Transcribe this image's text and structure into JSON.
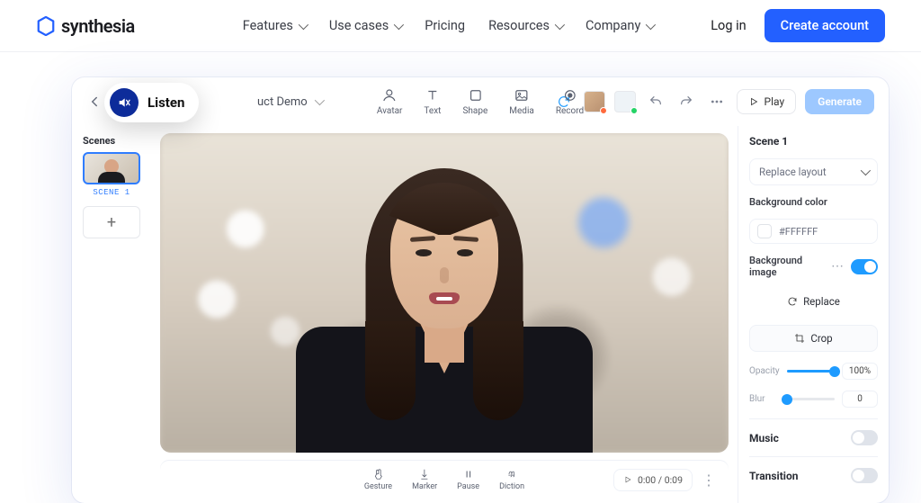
{
  "brand": "synthesia",
  "nav": {
    "items": [
      "Features",
      "Use cases",
      "Pricing",
      "Resources",
      "Company"
    ],
    "login": "Log in",
    "cta": "Create account"
  },
  "listenPill": "Listen",
  "projectName": "uct Demo",
  "toolbar": {
    "avatar": "Avatar",
    "text": "Text",
    "shape": "Shape",
    "media": "Media",
    "record": "Record",
    "play": "Play",
    "generate": "Generate"
  },
  "scenes": {
    "heading": "Scenes",
    "items": [
      {
        "label": "SCENE 1"
      }
    ],
    "add": "+"
  },
  "footer": {
    "gesture": "Gesture",
    "marker": "Marker",
    "pause": "Pause",
    "diction": "Diction",
    "time": "0:00 / 0:09"
  },
  "panel": {
    "sceneTitle": "Scene 1",
    "replaceLayout": "Replace layout",
    "bgColorLabel": "Background color",
    "bgColorValue": "#FFFFFF",
    "bgImageLabel": "Background image",
    "replace": "Replace",
    "crop": "Crop",
    "opacityLabel": "Opacity",
    "opacityValue": "100%",
    "opacityPct": 100,
    "blurLabel": "Blur",
    "blurValue": "0",
    "blurPct": 0,
    "music": "Music",
    "transition": "Transition"
  }
}
